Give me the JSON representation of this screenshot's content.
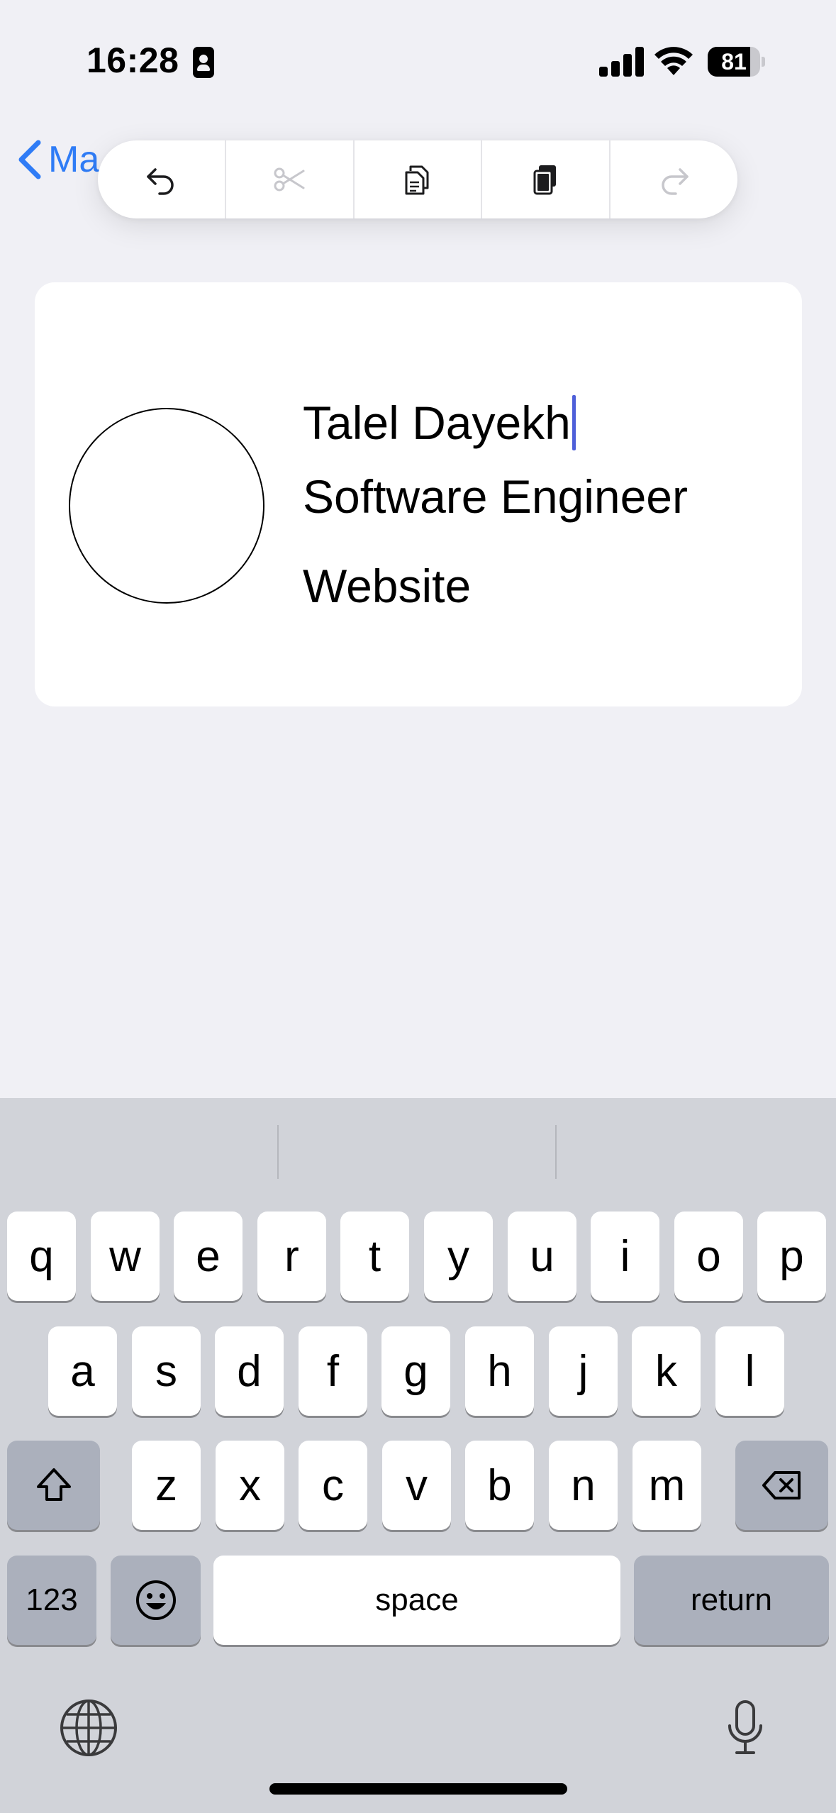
{
  "status_bar": {
    "time": "16:28",
    "battery_level": "81",
    "battery_fraction": 0.81
  },
  "nav": {
    "back_label": "Ma"
  },
  "edit_menu": {
    "items": [
      {
        "name": "undo",
        "enabled": true
      },
      {
        "name": "cut",
        "enabled": false
      },
      {
        "name": "copy",
        "enabled": true
      },
      {
        "name": "paste",
        "enabled": true
      },
      {
        "name": "redo",
        "enabled": false
      }
    ]
  },
  "card": {
    "name": "Talel Dayekh",
    "title": "Software Engineer",
    "website": "Website"
  },
  "keyboard": {
    "row1": [
      "q",
      "w",
      "e",
      "r",
      "t",
      "y",
      "u",
      "i",
      "o",
      "p"
    ],
    "row2": [
      "a",
      "s",
      "d",
      "f",
      "g",
      "h",
      "j",
      "k",
      "l"
    ],
    "row3": [
      "z",
      "x",
      "c",
      "v",
      "b",
      "n",
      "m"
    ],
    "numbers_label": "123",
    "space_label": "space",
    "return_label": "return"
  },
  "colors": {
    "accent": "#2f7cf6",
    "caret": "#4e5fd9",
    "background": "#f0f0f5",
    "keyboard": "#d1d3d9"
  },
  "icons": [
    "contact-card-icon",
    "signal-icon",
    "wifi-icon",
    "battery-icon",
    "back-chevron-icon",
    "undo-icon",
    "cut-icon",
    "copy-icon",
    "paste-icon",
    "redo-icon",
    "shift-icon",
    "delete-icon",
    "emoji-icon",
    "globe-icon",
    "mic-icon"
  ]
}
